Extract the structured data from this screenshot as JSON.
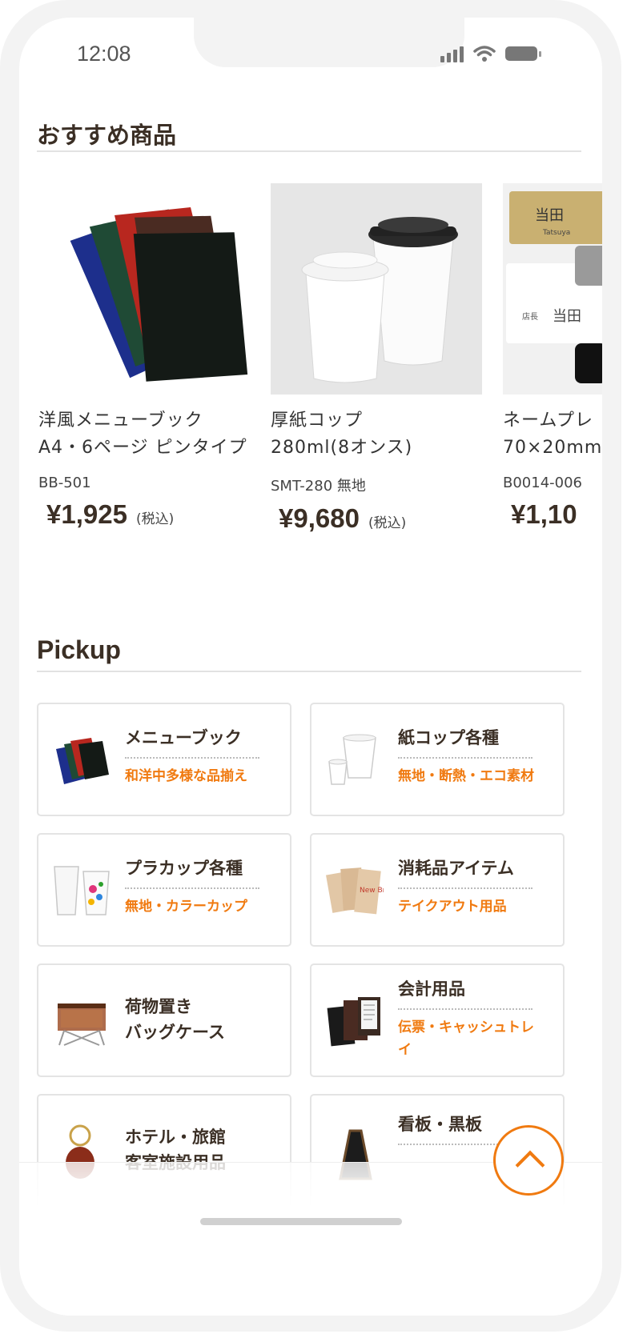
{
  "status_bar": {
    "time": "12:08"
  },
  "recommended": {
    "title": "おすすめ商品",
    "products": [
      {
        "name_line1": "洋風メニューブック",
        "name_line2": "A4・6ページ ピンタイプ",
        "code": "BB-501",
        "price": "¥1,925",
        "tax": "(税込)"
      },
      {
        "name_line1": "厚紙コップ",
        "name_line2": "280ml(8オンス)",
        "code": "SMT-280 無地",
        "price": "¥9,680",
        "tax": "(税込)"
      },
      {
        "name_line1": "ネームプレ",
        "name_line2": "70×20mm",
        "code": "B0014-006",
        "price": "¥1,10",
        "tax": "",
        "image_text_top": "当田",
        "image_text_sub": "Tatsuya",
        "image_text_role": "店長",
        "image_text_name": "当田"
      }
    ]
  },
  "pickup": {
    "title": "Pickup",
    "cards": [
      {
        "title": "メニューブック",
        "subtitle": "和洋中多様な品揃え",
        "icon": "menu-book-icon"
      },
      {
        "title": "紙コップ各種",
        "subtitle": "無地・断熱・エコ素材",
        "icon": "paper-cup-icon"
      },
      {
        "title": "プラカップ各種",
        "subtitle": "無地・カラーカップ",
        "icon": "plastic-cup-icon"
      },
      {
        "title": "消耗品アイテム",
        "subtitle": "テイクアウト用品",
        "icon": "takeout-bag-icon",
        "icon_text": "New Bread"
      },
      {
        "title_line1": "荷物置き",
        "title_line2": "バッグケース",
        "icon": "bag-case-icon"
      },
      {
        "title": "会計用品",
        "subtitle_line1": "伝票・キャッシュトレ",
        "subtitle_line2": "イ",
        "icon": "check-holder-icon"
      },
      {
        "title_line1": "ホテル・旅館",
        "title_line2": "客室施設用品",
        "icon": "key-holder-icon"
      },
      {
        "title": "看板・黒板",
        "icon": "sign-board-icon"
      }
    ]
  },
  "colors": {
    "accent": "#f07a10",
    "heading": "#3b2f25",
    "frame": "#f3f3f3"
  },
  "scroll_top": {
    "icon": "chevron-up-icon"
  }
}
